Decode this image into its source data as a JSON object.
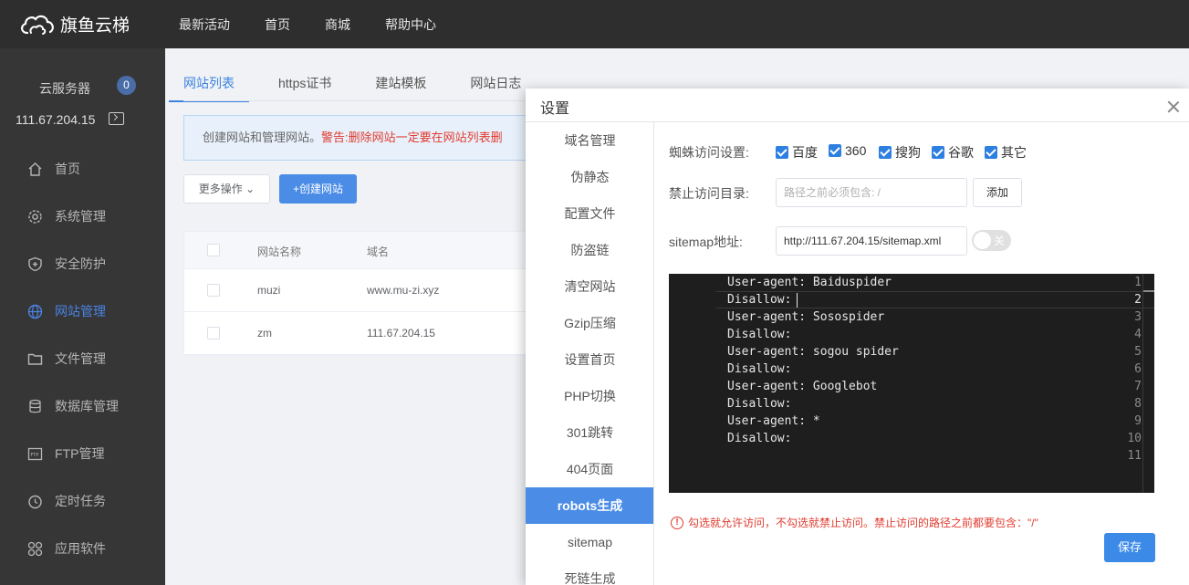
{
  "app": {
    "name": "旗鱼云梯"
  },
  "topnav": [
    "最新活动",
    "首页",
    "商城",
    "帮助中心"
  ],
  "sidebar": {
    "server_label": "云服务器",
    "server_count": "0",
    "ip": "111.67.204.15",
    "items": [
      {
        "label": "首页",
        "icon": "home-icon"
      },
      {
        "label": "系统管理",
        "icon": "gear-icon"
      },
      {
        "label": "安全防护",
        "icon": "shield-icon"
      },
      {
        "label": "网站管理",
        "icon": "globe-icon",
        "active": true
      },
      {
        "label": "文件管理",
        "icon": "folder-icon"
      },
      {
        "label": "数据库管理",
        "icon": "database-icon"
      },
      {
        "label": "FTP管理",
        "icon": "ftp-icon"
      },
      {
        "label": "定时任务",
        "icon": "clock-icon"
      },
      {
        "label": "应用软件",
        "icon": "apps-icon"
      }
    ]
  },
  "main": {
    "tabs": [
      "网站列表",
      "https证书",
      "建站模板",
      "网站日志"
    ],
    "notice_text": "创建网站和管理网站。",
    "notice_warn": "警告:删除网站一定要在网站列表删",
    "more_button": "更多操作",
    "create_button": "+创建网站",
    "table": {
      "headers": [
        "网站名称",
        "域名"
      ],
      "rows": [
        [
          "muzi",
          "www.mu-zi.xyz"
        ],
        [
          "zm",
          "111.67.204.15"
        ]
      ]
    }
  },
  "dialog": {
    "title": "设置",
    "menu": [
      "域名管理",
      "伪静态",
      "配置文件",
      "防盗链",
      "清空网站",
      "Gzip压缩",
      "设置首页",
      "PHP切换",
      "301跳转",
      "404页面",
      "robots生成",
      "sitemap",
      "死链生成"
    ],
    "active_menu": "robots生成",
    "spider_label": "蜘蛛访问设置:",
    "spiders": [
      "百度",
      "360",
      "搜狗",
      "谷歌",
      "其它"
    ],
    "forbid_label": "禁止访问目录:",
    "forbid_placeholder": "路径之前必须包含: /",
    "add_button": "添加",
    "sitemap_label": "sitemap地址:",
    "sitemap_value": "http://111.67.204.15/sitemap.xml",
    "toggle_label": "关",
    "code_lines": [
      "User-agent: Baiduspider",
      "Disallow:",
      "User-agent: Sosospider",
      "Disallow:",
      "User-agent: sogou spider",
      "Disallow:",
      "User-agent: Googlebot",
      "Disallow:",
      "User-agent: *",
      "Disallow:",
      ""
    ],
    "hint": "勾选就允许访问，不勾选就禁止访问。禁止访问的路径之前都要包含：\"/\"",
    "save_button": "保存"
  }
}
